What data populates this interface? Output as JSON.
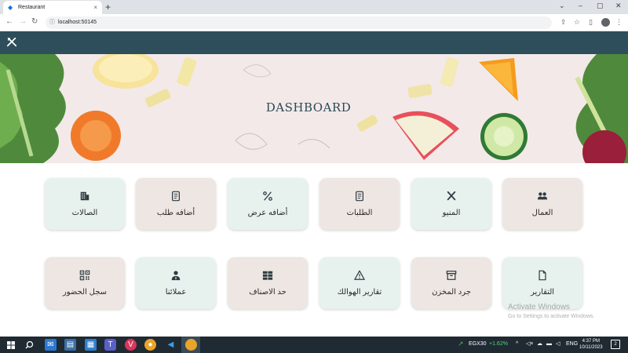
{
  "browser": {
    "tab_title": "Restaurant",
    "close_glyph": "×",
    "new_tab_glyph": "+",
    "url": "localhost:50145",
    "window_controls": [
      "⌄",
      "–",
      "▢",
      "✕"
    ]
  },
  "app": {
    "title": "DASHBOARD",
    "brand_color": "#2e4e5b"
  },
  "cards": [
    {
      "label": "العمال",
      "icon": "users-icon"
    },
    {
      "label": "المنيو",
      "icon": "utensils-icon"
    },
    {
      "label": "الطلبات",
      "icon": "document-icon"
    },
    {
      "label": "أضافه عرض",
      "icon": "percent-icon"
    },
    {
      "label": "أضافه طلب",
      "icon": "document-icon"
    },
    {
      "label": "الصالات",
      "icon": "building-icon"
    },
    {
      "label": "التقارير",
      "icon": "file-icon"
    },
    {
      "label": "جرد المخزن",
      "icon": "archive-icon"
    },
    {
      "label": "تقارير الهوالك",
      "icon": "warning-icon"
    },
    {
      "label": "حد الاصناف",
      "icon": "table-icon"
    },
    {
      "label": "عملائنا",
      "icon": "user-tie-icon"
    },
    {
      "label": "سجل الحضور",
      "icon": "qrcode-icon"
    }
  ],
  "watermark": {
    "line1": "Activate Windows",
    "line2": "Go to Settings to activate Windows."
  },
  "taskbar": {
    "stock_label": "EGX30",
    "stock_change": "+1.62%",
    "language": "ENG",
    "time": "4:37 PM",
    "date": "10/11/2023",
    "notifications": "2"
  }
}
